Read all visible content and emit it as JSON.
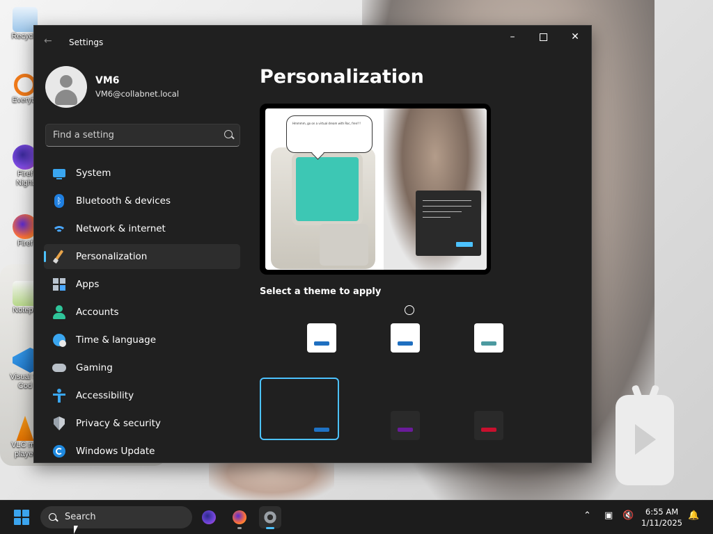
{
  "desktop": {
    "icons": [
      {
        "label": "Recycle",
        "icon": "recycle-bin-icon",
        "color": "#5aa0d8"
      },
      {
        "label": "Everyth",
        "icon": "everything-search-icon",
        "color": "#f07a1a"
      },
      {
        "label": "Firef\nNight",
        "icon": "firefox-nightly-icon",
        "color": "#7b4ae0"
      },
      {
        "label": "Firef",
        "icon": "firefox-icon",
        "color": "#ff7139"
      },
      {
        "label": "Notepa",
        "icon": "notepad-plus-plus-icon",
        "color": "#8bc34a"
      },
      {
        "label": "Visual St\nCod",
        "icon": "vscode-icon",
        "color": "#2b8fe0"
      },
      {
        "label": "VLC me\nplayer",
        "icon": "vlc-icon",
        "color": "#f08a00"
      }
    ]
  },
  "window": {
    "title": "Settings",
    "controls": {
      "minimize": "–",
      "close": "✕"
    }
  },
  "user": {
    "name": "VM6",
    "email": "VM6@collabnet.local"
  },
  "search": {
    "placeholder": "Find a setting"
  },
  "nav": {
    "items": [
      {
        "label": "System",
        "icon": "system-icon"
      },
      {
        "label": "Bluetooth & devices",
        "icon": "bluetooth-icon"
      },
      {
        "label": "Network & internet",
        "icon": "wifi-icon"
      },
      {
        "label": "Personalization",
        "icon": "brush-icon",
        "active": true
      },
      {
        "label": "Apps",
        "icon": "apps-icon"
      },
      {
        "label": "Accounts",
        "icon": "person-icon"
      },
      {
        "label": "Time & language",
        "icon": "globe-clock-icon"
      },
      {
        "label": "Gaming",
        "icon": "controller-icon"
      },
      {
        "label": "Accessibility",
        "icon": "accessibility-icon"
      },
      {
        "label": "Privacy & security",
        "icon": "shield-icon"
      },
      {
        "label": "Windows Update",
        "icon": "update-icon"
      }
    ]
  },
  "main": {
    "title": "Personalization",
    "preview_bubble_text": "Hmmmm, go on a virtual dream with Roc, fren!!!",
    "theme_section_label": "Select a theme to apply",
    "themes": [
      {
        "name": "light-blue",
        "background": "#ffffff",
        "accent": "#1f6fc0",
        "selected": false
      },
      {
        "name": "light-blue-2",
        "background": "#ffffff",
        "accent": "#1f6fc0",
        "selected": false
      },
      {
        "name": "light-teal",
        "background": "#ffffff",
        "accent": "#4c9aa0",
        "selected": false
      },
      {
        "name": "dark-blue",
        "background": "#202020",
        "accent": "#1f72c4",
        "selected": true
      },
      {
        "name": "dark-purple",
        "background": "#202020",
        "accent": "#6a1b9a",
        "selected": false
      },
      {
        "name": "dark-red",
        "background": "#202020",
        "accent": "#c8102e",
        "selected": false
      }
    ]
  },
  "taskbar": {
    "search_label": "Search",
    "apps": [
      {
        "name": "firefox-nightly-taskbar-icon",
        "color": "#6b44d6"
      },
      {
        "name": "firefox-taskbar-icon",
        "color": "#ff7139"
      },
      {
        "name": "settings-taskbar-icon",
        "color": "#9aa0a6",
        "active": true
      }
    ],
    "time": "6:55 AM",
    "date": "1/11/2025"
  },
  "colors": {
    "accent": "#4cc2ff",
    "window_bg": "#202020",
    "taskbar_bg": "#1c1c1c"
  }
}
